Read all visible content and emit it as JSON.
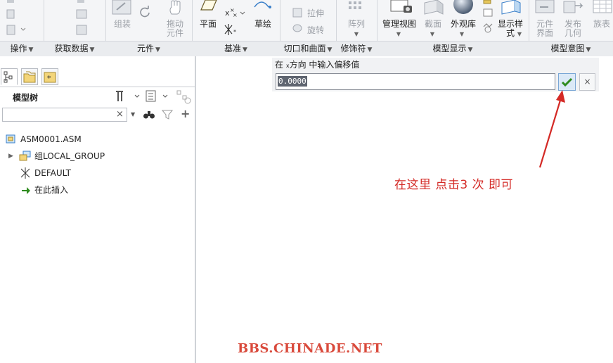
{
  "ribbon": {
    "tools": {
      "assemble": "组装",
      "drag_components": "拖动\n元件",
      "plane": "平面",
      "sketch": "草绘",
      "extrude": "拉伸",
      "revolve": "旋转",
      "pattern": "阵列",
      "manage_views": "管理视图",
      "section": "截面",
      "appearance": "外观库",
      "display_style": "显示样\n式",
      "component_interface": "元件\n界面",
      "publish_geometry": "发布\n几何",
      "family_table": "族表"
    },
    "groups": {
      "operations": "操作",
      "get_data": "获取数据",
      "component": "元件",
      "datum": "基准",
      "cut_surface": "切口和曲面",
      "modifiers": "修饰符",
      "model_display": "模型显示",
      "model_intent": "模型意图"
    }
  },
  "left_panel": {
    "title": "模型树",
    "filter_placeholder": "",
    "tree": [
      {
        "label": "ASM0001.ASM",
        "icon": "assembly-icon"
      },
      {
        "label": "组LOCAL_GROUP",
        "icon": "group-icon"
      },
      {
        "label": "DEFAULT",
        "icon": "csys-icon"
      },
      {
        "label": "在此插入",
        "icon": "insert-arrow-icon"
      }
    ]
  },
  "offset_dialog": {
    "prompt_before": "在",
    "prompt_sub": "x",
    "prompt_after": "方向 中输入偏移值",
    "value": "0.0000",
    "cancel_label": "×"
  },
  "annotation": "在这里 点击3 次 即可",
  "watermark": "BBS.CHINADE.NET",
  "colors": {
    "annotation": "#d42a26",
    "accept_check": "#2e8b1e",
    "ribbon_bg": "#f4f5f7"
  }
}
